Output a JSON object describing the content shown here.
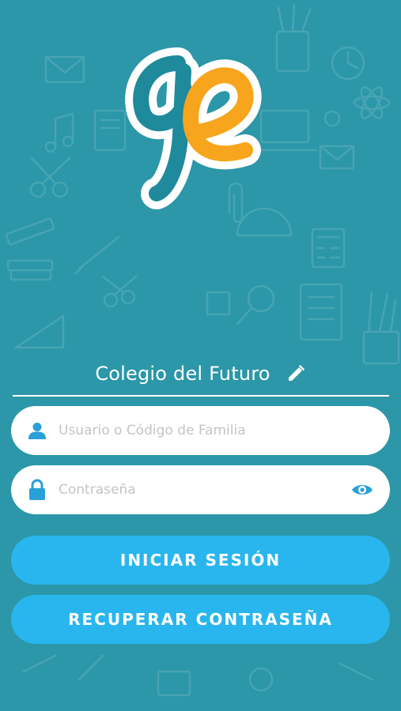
{
  "app": {
    "school_name": "Colegio del Futuro"
  },
  "form": {
    "username_placeholder": "Usuario o Código de Familia",
    "username_value": "",
    "password_placeholder": "Contraseña",
    "password_value": ""
  },
  "buttons": {
    "login_label": "INICIAR SESIÓN",
    "recover_label": "RECUPERAR CONTRASEÑA"
  },
  "icons": {
    "logo": "ge-logo",
    "edit": "pencil-icon",
    "user": "user-icon",
    "lock": "lock-icon",
    "show_password": "eye-icon"
  },
  "colors": {
    "background": "#2b97a8",
    "button": "#29b6ee",
    "icon": "#29a0d8",
    "logo_teal": "#1e8a9c",
    "logo_orange": "#f7a51c"
  }
}
